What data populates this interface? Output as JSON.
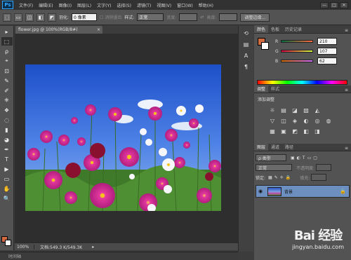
{
  "app": {
    "logo": "Ps",
    "menu": [
      "文件(F)",
      "编辑(E)",
      "图像(I)",
      "图层(L)",
      "文字(Y)",
      "选择(S)",
      "滤镜(T)",
      "视图(V)",
      "窗口(W)",
      "帮助(H)"
    ],
    "window_controls": [
      "—",
      "□",
      "✕"
    ]
  },
  "options_bar": {
    "feather_label": "羽化:",
    "feather_value": "0 像素",
    "antialias_label": "消除锯齿",
    "style_label": "样式:",
    "style_value": "正常",
    "width_label": "宽度:",
    "height_label": "高度:",
    "refine_edge_button": "调整边缘..."
  },
  "document": {
    "tab_title": "flower.jpg @ 100%(RGB/8#)",
    "tab_close": "×",
    "zoom": "100%",
    "doc_info": "文档:549.3 K/549.3K",
    "status_arrow": "▸"
  },
  "mini_bridge": {
    "label": "时间轴"
  },
  "color_panel": {
    "tabs": [
      "颜色",
      "色板",
      "历史记录"
    ],
    "channels": [
      {
        "name": "R",
        "value": "210",
        "gradient_start": "#006b3e",
        "gradient_end": "#ff6b3e"
      },
      {
        "name": "G",
        "value": "107",
        "gradient_start": "#d2003e",
        "gradient_end": "#d2ff3e"
      },
      {
        "name": "B",
        "value": "62",
        "gradient_start": "#d26b00",
        "gradient_end": "#d26bff"
      }
    ],
    "foreground_color": "#d26b3e",
    "background_color": "#ffffff"
  },
  "adjustments_panel": {
    "tabs": [
      "调整",
      "样式"
    ],
    "title": "添加调整",
    "icons": [
      "☼",
      "▤",
      "◪",
      "▧",
      "◭",
      "▽",
      "◫",
      "◈",
      "◐",
      "◎",
      "◍",
      "▦",
      "▣",
      "◩",
      "◧",
      "◨",
      "▨"
    ]
  },
  "layers_panel": {
    "tabs": [
      "图层",
      "通道",
      "路径"
    ],
    "filter_label": "ρ 类型",
    "blend_mode": "正常",
    "opacity_label": "不透明度:",
    "lock_label": "锁定:",
    "fill_label": "填充:",
    "layer_name": "背景",
    "footer_icons": [
      "⊖",
      "fx",
      "◐",
      "▭",
      "▢",
      "🗑"
    ]
  },
  "tools": [
    "▸",
    "⬚",
    "ρ",
    "⌖",
    "⊡",
    "✎",
    "✐",
    "⎈",
    "❖",
    "◌",
    "▮",
    "◕",
    "✒",
    "T",
    "▶",
    "▭",
    "✋",
    "🔍"
  ],
  "watermark": {
    "logo": "Bai 经验",
    "url": "jingyan.baidu.com"
  }
}
